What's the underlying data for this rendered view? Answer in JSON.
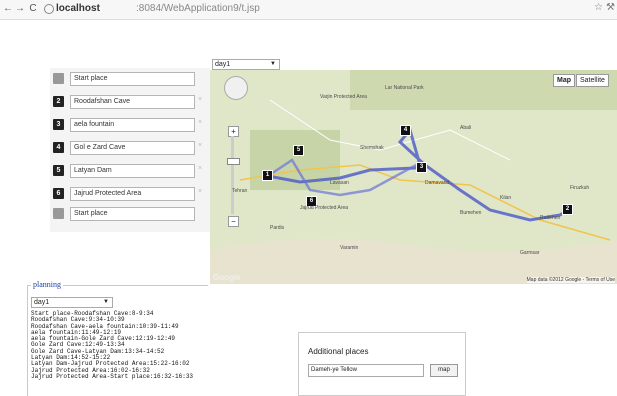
{
  "browser": {
    "back_icon": "←",
    "forward_icon": "→",
    "reload_icon": "C",
    "address_host": "localhost",
    "address_path": ":8084/WebApplication9/t.jsp",
    "star_icon": "☆",
    "wrench_icon": "⚒"
  },
  "day_select": {
    "value": "day1",
    "arrow": "▼"
  },
  "waypoints": [
    {
      "num": "",
      "label": "Start place"
    },
    {
      "num": "2",
      "label": "Roodafshan Cave"
    },
    {
      "num": "3",
      "label": "aela fountain"
    },
    {
      "num": "4",
      "label": "Gol e Zard Cave"
    },
    {
      "num": "5",
      "label": "Latyan Dam"
    },
    {
      "num": "6",
      "label": "Jajrud Protected Area"
    },
    {
      "num": "",
      "label": "Start place"
    }
  ],
  "waypoint_remove": "×",
  "map": {
    "map_btn": "Map",
    "satellite_btn": "Satellite",
    "logo": "Google",
    "credit": "Map data ©2012 Google - Terms of Use",
    "zoom_plus": "+",
    "zoom_minus": "−",
    "markers": [
      "1",
      "2",
      "3",
      "4",
      "5",
      "6"
    ],
    "labels": [
      "Lar National Park",
      "Varjin Protected Area",
      "Jajrud Protected Area",
      "Tehran",
      "Damavand",
      "Rudehen",
      "Firuzkuh",
      "Lavasan",
      "Shemshak",
      "Abali",
      "Garmsar",
      "Pardis",
      "Bumehen",
      "Varamin",
      "Kilan"
    ]
  },
  "planning": {
    "legend": "planning",
    "select_value": "day1",
    "lines": [
      "Start place-Roodafshan Cave:8-9:34",
      "Roodafshan Cave:9:34-10:39",
      "Roodafshan Cave-aela fountain:10:39-11:49",
      "aela fountain:11:49-12:19",
      "aela fountain-Gole Zard Cave:12:19-12:49",
      "Gole Zard Cave:12:49-13:34",
      "Gole Zard Cave-Latyan Dam:13:34-14:52",
      "Latyan Dam:14:52-15:22",
      "Latyan Dam-Jajrud Protected Area:15:22-16:02",
      "Jajrud Protected Area:16:02-16:32",
      "Jajrud Protected Area-Start place:16:32-16:33"
    ]
  },
  "additional": {
    "title": "Additional places",
    "input_value": "Dameh-ye Tellow",
    "button": "map"
  }
}
